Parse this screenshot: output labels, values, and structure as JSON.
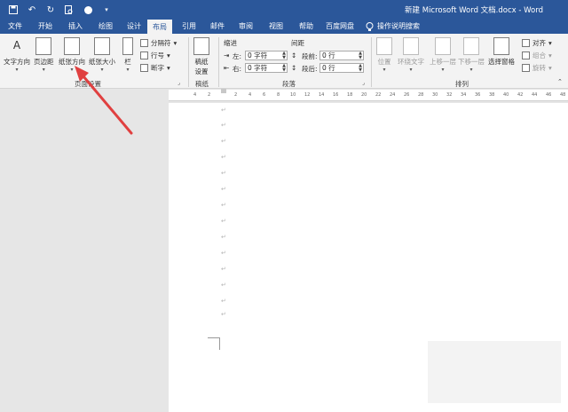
{
  "title_bar": {
    "doc_title": "新建 Microsoft Word 文档.docx - Word"
  },
  "tabs": [
    {
      "label": "文件"
    },
    {
      "label": "开始"
    },
    {
      "label": "插入"
    },
    {
      "label": "绘图"
    },
    {
      "label": "设计"
    },
    {
      "label": "布局"
    },
    {
      "label": "引用"
    },
    {
      "label": "邮件"
    },
    {
      "label": "审阅"
    },
    {
      "label": "视图"
    },
    {
      "label": "帮助"
    },
    {
      "label": "百度网盘"
    }
  ],
  "tell_me": "操作说明搜索",
  "ribbon": {
    "page_setup": {
      "text_direction": "文字方向",
      "margins": "页边距",
      "orientation": "纸张方向",
      "size": "纸张大小",
      "columns": "栏",
      "breaks": "分隔符",
      "line_numbers": "行号",
      "hyphenation": "断字",
      "group_label": "页面设置"
    },
    "draft": {
      "draft_settings_line1": "稿纸",
      "draft_settings_line2": "设置",
      "group_label": "稿纸"
    },
    "paragraph": {
      "indent_label": "缩进",
      "spacing_label": "间距",
      "left_label": "左:",
      "right_label": "右:",
      "before_label": "段前:",
      "after_label": "段后:",
      "left_value": "0 字符",
      "right_value": "0 字符",
      "before_value": "0 行",
      "after_value": "0 行",
      "group_label": "段落"
    },
    "arrange": {
      "position": "位置",
      "wrap_text": "环绕文字",
      "bring_forward": "上移一层",
      "send_backward": "下移一层",
      "selection_pane": "选择窗格",
      "align": "对齐",
      "group": "组合",
      "rotate": "旋转",
      "group_label": "排列"
    }
  },
  "ruler_labels": [
    "2",
    "4",
    "6",
    "8",
    "10",
    "12",
    "14",
    "16",
    "18",
    "20",
    "22",
    "24",
    "26",
    "28",
    "30",
    "32",
    "34",
    "36",
    "38",
    "40",
    "42",
    "44",
    "46",
    "48"
  ],
  "ruler_left_labels": [
    "4",
    "2"
  ],
  "paragraph_mark": "↵",
  "colors": {
    "accent": "#2b579a",
    "annotation_arrow": "#e04040"
  }
}
